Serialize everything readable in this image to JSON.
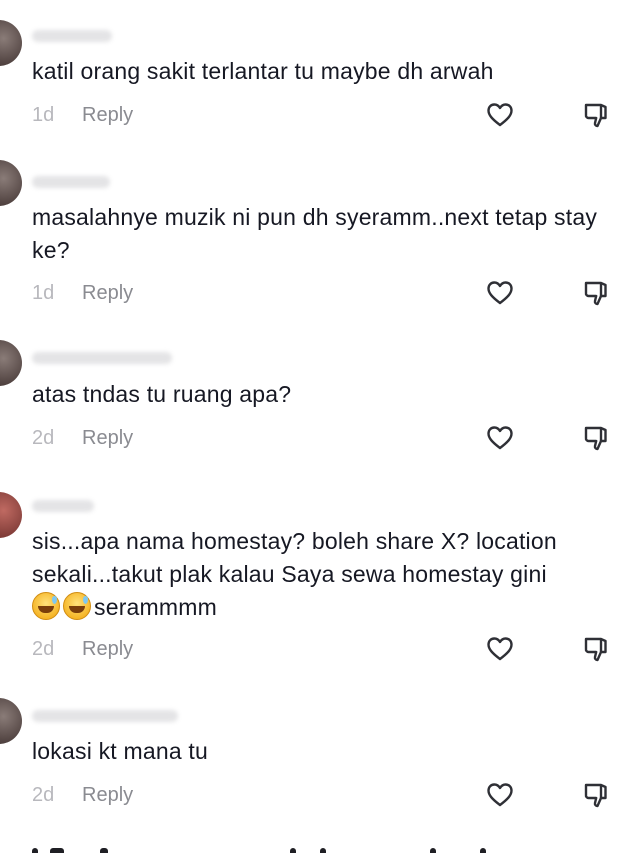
{
  "comments": [
    {
      "text": "katil orang sakit terlantar tu maybe dh arwah",
      "time": "1d",
      "reply_label": "Reply"
    },
    {
      "text": "masalahnye muzik ni pun dh syeramm..next tetap stay ke?",
      "time": "1d",
      "reply_label": "Reply"
    },
    {
      "text": "atas tndas tu ruang apa?",
      "time": "2d",
      "reply_label": "Reply"
    },
    {
      "text_main": "sis...apa nama homestay? boleh share X? location sekali...takut plak kalau Saya sewa homestay gini",
      "text_tail": "serammmm",
      "emoji_name": "sweat-smile-emoji",
      "time": "2d",
      "reply_label": "Reply"
    },
    {
      "text": "lokasi kt mana tu",
      "time": "2d",
      "reply_label": "Reply"
    }
  ],
  "icons": {
    "like": "heart-outline-icon",
    "dislike": "thumbs-down-icon"
  },
  "colors": {
    "text": "#161823",
    "secondary": "#8a8b91",
    "timestamp": "#b8b8bd",
    "icon": "#2f3036"
  }
}
